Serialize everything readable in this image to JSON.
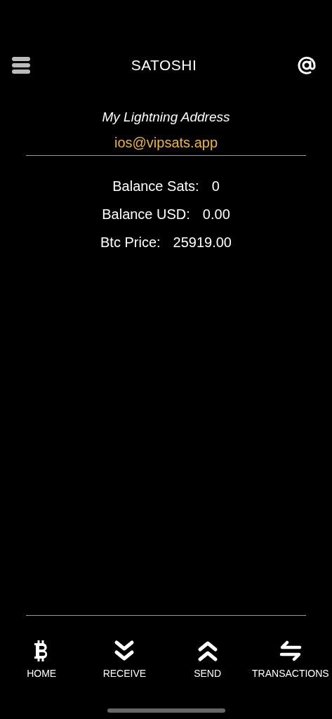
{
  "header": {
    "title": "SATOSHI"
  },
  "address": {
    "label": "My Lightning Address",
    "value": "ios@vipsats.app"
  },
  "balances": [
    {
      "label": "Balance Sats:",
      "value": "0"
    },
    {
      "label": "Balance USD:",
      "value": "0.00"
    },
    {
      "label": "Btc Price:",
      "value": "25919.00"
    }
  ],
  "tabs": [
    {
      "kind": "home",
      "label": "HOME"
    },
    {
      "kind": "receive",
      "label": "RECEIVE"
    },
    {
      "kind": "send",
      "label": "SEND"
    },
    {
      "kind": "transactions",
      "label": "TRANSACTIONS"
    }
  ]
}
